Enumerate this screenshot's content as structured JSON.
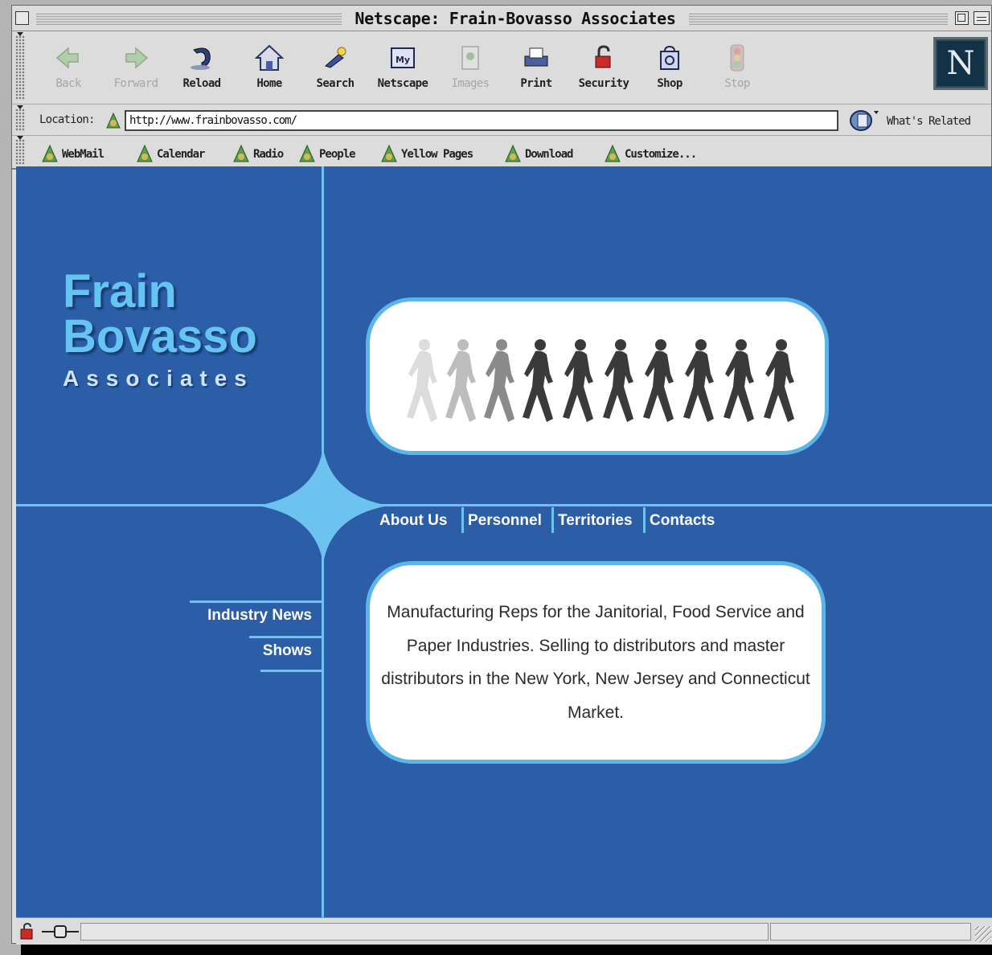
{
  "window": {
    "title": "Netscape: Frain-Bovasso Associates"
  },
  "navigation_toolbar": {
    "buttons": [
      {
        "label": "Back",
        "icon": "back-arrow-icon",
        "enabled": false
      },
      {
        "label": "Forward",
        "icon": "forward-arrow-icon",
        "enabled": false
      },
      {
        "label": "Reload",
        "icon": "reload-icon",
        "enabled": true
      },
      {
        "label": "Home",
        "icon": "home-icon",
        "enabled": true
      },
      {
        "label": "Search",
        "icon": "search-icon",
        "enabled": true
      },
      {
        "label": "Netscape",
        "icon": "my-netscape-icon",
        "enabled": true
      },
      {
        "label": "Images",
        "icon": "images-icon",
        "enabled": false
      },
      {
        "label": "Print",
        "icon": "print-icon",
        "enabled": true
      },
      {
        "label": "Security",
        "icon": "security-lock-icon",
        "enabled": true
      },
      {
        "label": "Shop",
        "icon": "shop-bag-icon",
        "enabled": true
      },
      {
        "label": "Stop",
        "icon": "stop-icon",
        "enabled": false
      }
    ],
    "logo_letter": "N"
  },
  "location_bar": {
    "label": "Location:",
    "url": "http://www.frainbovasso.com/",
    "whats_related_label": "What's Related"
  },
  "personal_toolbar": {
    "items": [
      {
        "label": "WebMail"
      },
      {
        "label": "Calendar"
      },
      {
        "label": "Radio"
      },
      {
        "label": "People"
      },
      {
        "label": "Yellow Pages"
      },
      {
        "label": "Download"
      },
      {
        "label": "Customize..."
      }
    ]
  },
  "page": {
    "logo": {
      "line1": "Frain",
      "line2": "Bovasso",
      "line3": "Associates"
    },
    "tabs": [
      {
        "label": "About Us"
      },
      {
        "label": "Personnel"
      },
      {
        "label": "Territories"
      },
      {
        "label": "Contacts"
      }
    ],
    "side_links": [
      {
        "label": "Industry News"
      },
      {
        "label": "Shows"
      }
    ],
    "description": "Manufacturing Reps for the Janitorial, Food Service and Paper Industries. Selling to distributors and master distributors in the New York, New Jersey and Connecticut Market.",
    "colors": {
      "background": "#2b5ea6",
      "accent_light_blue": "#6cc3f0",
      "logo_text": "#66c4f2"
    }
  },
  "status_bar": {
    "status_text": ""
  }
}
